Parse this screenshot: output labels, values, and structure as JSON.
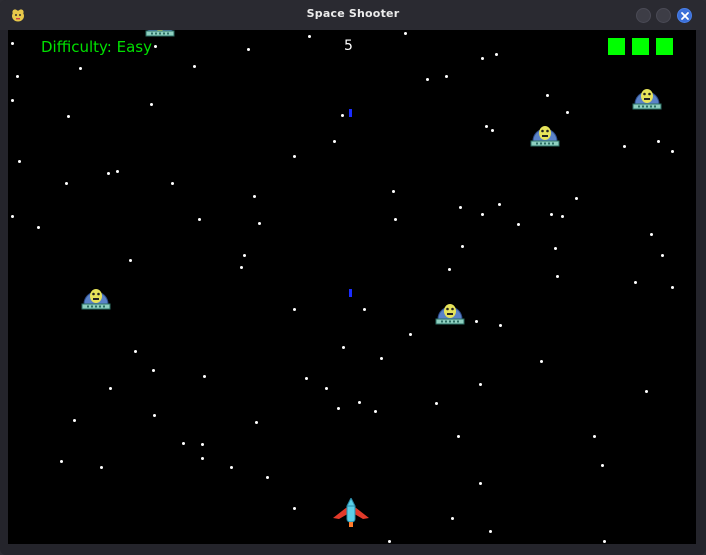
{
  "window": {
    "title": "Space Shooter",
    "icon": "pygame-snake-icon",
    "controls": [
      "minimize-button",
      "maximize-button",
      "close-button"
    ]
  },
  "hud": {
    "difficulty_label": "Difficulty: Easy",
    "score": "5",
    "lives_remaining": 3,
    "life_color": "#00ff00",
    "difficulty_color": "#00e000"
  },
  "entities": {
    "enemies": 5,
    "enemy_type": "alien-ufo",
    "player_bullets": 2,
    "bullet_color": "#1a2cff",
    "player_ship": "red-cyan-starfighter"
  },
  "colors": {
    "background": "#000000",
    "titlebar": "#2a2a31",
    "close_button": "#3a6fd8"
  }
}
